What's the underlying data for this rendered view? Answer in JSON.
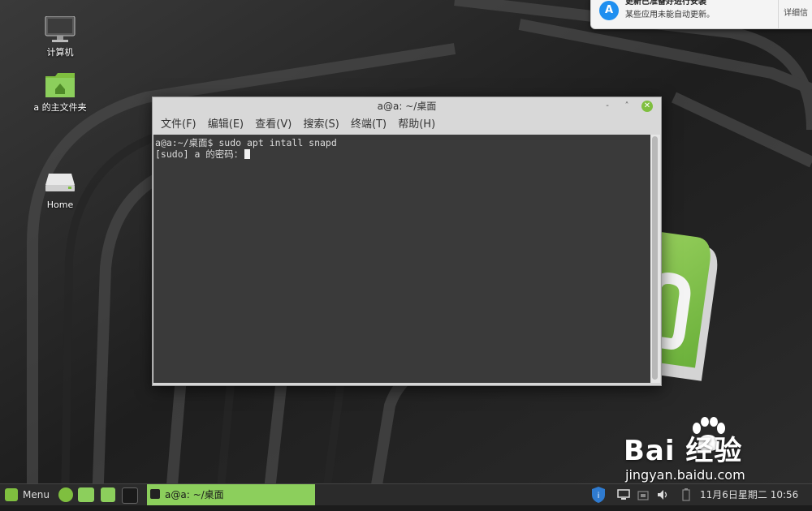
{
  "desktop": {
    "icons": [
      {
        "label": "计算机",
        "icon": "computer-icon"
      },
      {
        "label": "a 的主文件夹",
        "icon": "home-folder-icon"
      },
      {
        "label": "Home",
        "icon": "drive-icon"
      }
    ]
  },
  "notification": {
    "title": "更新已准备好进行安装",
    "body": "某些应用未能自动更新。",
    "action": "详细信",
    "icon": "app-store-icon"
  },
  "terminal": {
    "title": "a@a: ~/桌面",
    "menu": [
      "文件(F)",
      "编辑(E)",
      "查看(V)",
      "搜索(S)",
      "终端(T)",
      "帮助(H)"
    ],
    "lines": [
      "a@a:~/桌面$ sudo apt intall snapd",
      "[sudo] a 的密码："
    ],
    "buttons": {
      "minimize": "-",
      "maximize": "˄",
      "close": "✕"
    }
  },
  "watermark": {
    "brand": "Bai 经验",
    "url": "jingyan.baidu.com"
  },
  "taskbar": {
    "menu_label": "Menu",
    "active_task": "a@a: ~/桌面",
    "clock": "11月6日星期二  10:56"
  },
  "colors": {
    "mint_green": "#7fbf3f",
    "task_highlight": "#8ccf5c"
  }
}
